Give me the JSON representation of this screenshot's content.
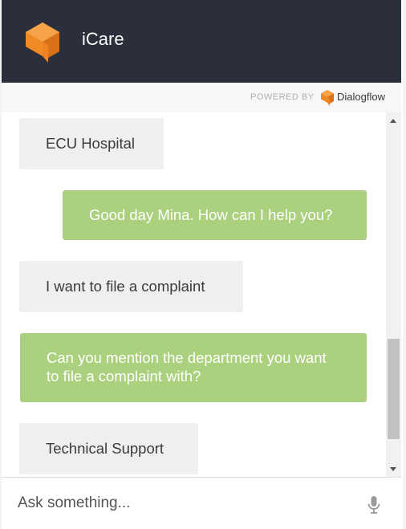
{
  "header": {
    "title": "iCare",
    "logo_icon": "dialogflow-cube-icon",
    "logo_color": "#f08a24",
    "background": "#2b2f3b"
  },
  "powered": {
    "label": "POWERED BY",
    "brand": "Dialogflow",
    "brand_icon": "dialogflow-logo-icon"
  },
  "messages": [
    {
      "sender": "bot",
      "text": "ECU Hospital"
    },
    {
      "sender": "user",
      "text": "Good day Mina. How can I help you?"
    },
    {
      "sender": "bot",
      "text": "I want to file a complaint"
    },
    {
      "sender": "user",
      "text": "Can you mention the department you want to file a complaint with?"
    },
    {
      "sender": "bot",
      "text": "Technical Support"
    }
  ],
  "colors": {
    "bot_bubble": "#efefef",
    "user_bubble": "#abd07e",
    "accent": "#f08a24"
  },
  "input": {
    "placeholder": "Ask something...",
    "value": "",
    "mic_icon": "microphone-icon"
  }
}
